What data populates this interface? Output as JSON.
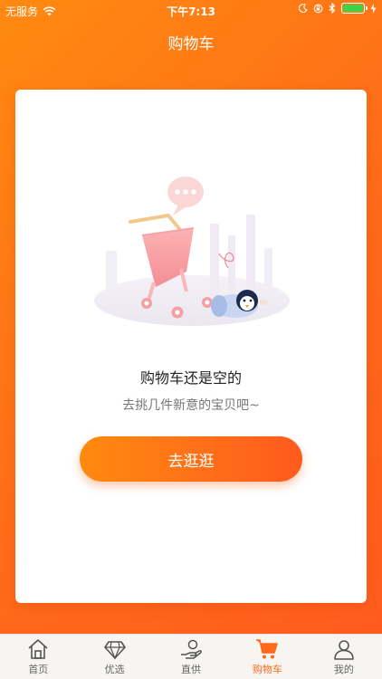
{
  "status_bar": {
    "carrier": "无服务",
    "time": "下午7:13",
    "battery_color": "#3bd44a"
  },
  "nav": {
    "title": "购物车"
  },
  "empty_state": {
    "illustration_icon": "empty-cart-illustration",
    "title": "购物车还是空的",
    "subtitle": "去挑几件新意的宝贝吧~",
    "button_label": "去逛逛"
  },
  "tabbar": {
    "items": [
      {
        "label": "首页",
        "icon": "home-icon",
        "active": false
      },
      {
        "label": "优选",
        "icon": "diamond-icon",
        "active": false
      },
      {
        "label": "直供",
        "icon": "hand-coin-icon",
        "active": false
      },
      {
        "label": "购物车",
        "icon": "cart-icon",
        "active": true
      },
      {
        "label": "我的",
        "icon": "person-icon",
        "active": false
      }
    ]
  },
  "colors": {
    "accent": "#ff6a1a",
    "accent_light": "#ff8a10",
    "tab_inactive": "#666666"
  }
}
